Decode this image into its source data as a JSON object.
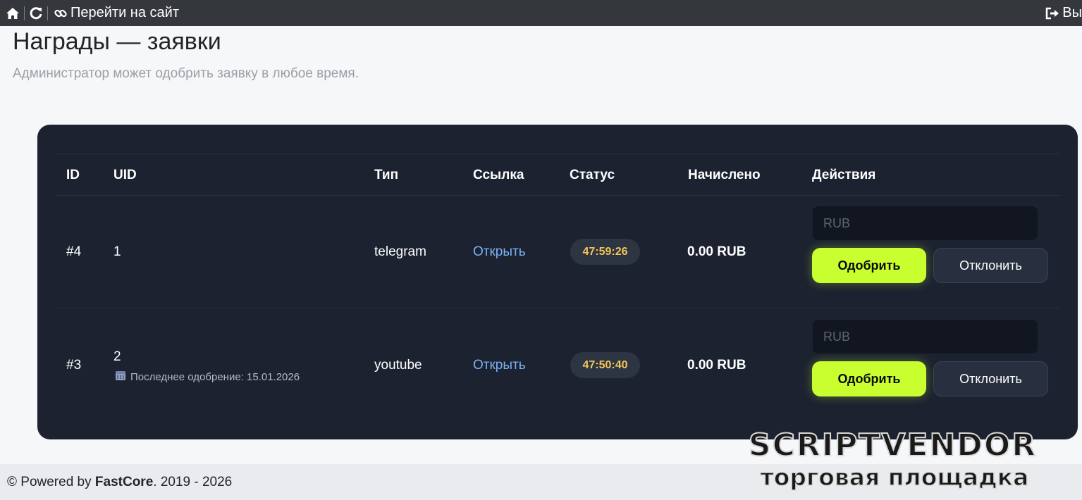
{
  "topbar": {
    "goto_site_label": "Перейти на сайт",
    "logout_label": "Вы"
  },
  "page": {
    "title": "Награды — заявки",
    "subtitle": "Администратор может одобрить заявку в любое время."
  },
  "table": {
    "headers": {
      "id": "ID",
      "uid": "UID",
      "type": "Тип",
      "link": "Ссылка",
      "status": "Статус",
      "credited": "Начислено",
      "actions": "Действия"
    },
    "rows": [
      {
        "id": "#4",
        "uid": "1",
        "last_approval": "",
        "type": "telegram",
        "link_label": "Открыть",
        "timer": "47:59:26",
        "credited": "0.00 RUB",
        "input_placeholder": "RUB",
        "approve_label": "Одобрить",
        "reject_label": "Отклонить"
      },
      {
        "id": "#3",
        "uid": "2",
        "last_approval": "Последнее одобрение: 15.01.2026",
        "type": "youtube",
        "link_label": "Открыть",
        "timer": "47:50:40",
        "credited": "0.00 RUB",
        "input_placeholder": "RUB",
        "approve_label": "Одобрить",
        "reject_label": "Отклонить"
      }
    ]
  },
  "footer": {
    "prefix": "© Powered by ",
    "brand": "FastCore",
    "suffix": ". 2019 - 2026"
  },
  "watermark": {
    "title": "SCRIPTVENDOR",
    "subtitle": "торговая площадка"
  },
  "colors": {
    "topbar_bg": "#34373c",
    "card_bg": "#1c2230",
    "accent_approve": "#c9ff2e",
    "link": "#7ab3f5",
    "timer_text": "#f3c65a"
  },
  "icons": {
    "home": "home-icon",
    "refresh": "refresh-icon",
    "link": "link-icon",
    "logout": "logout-icon",
    "calendar": "calendar-icon"
  }
}
